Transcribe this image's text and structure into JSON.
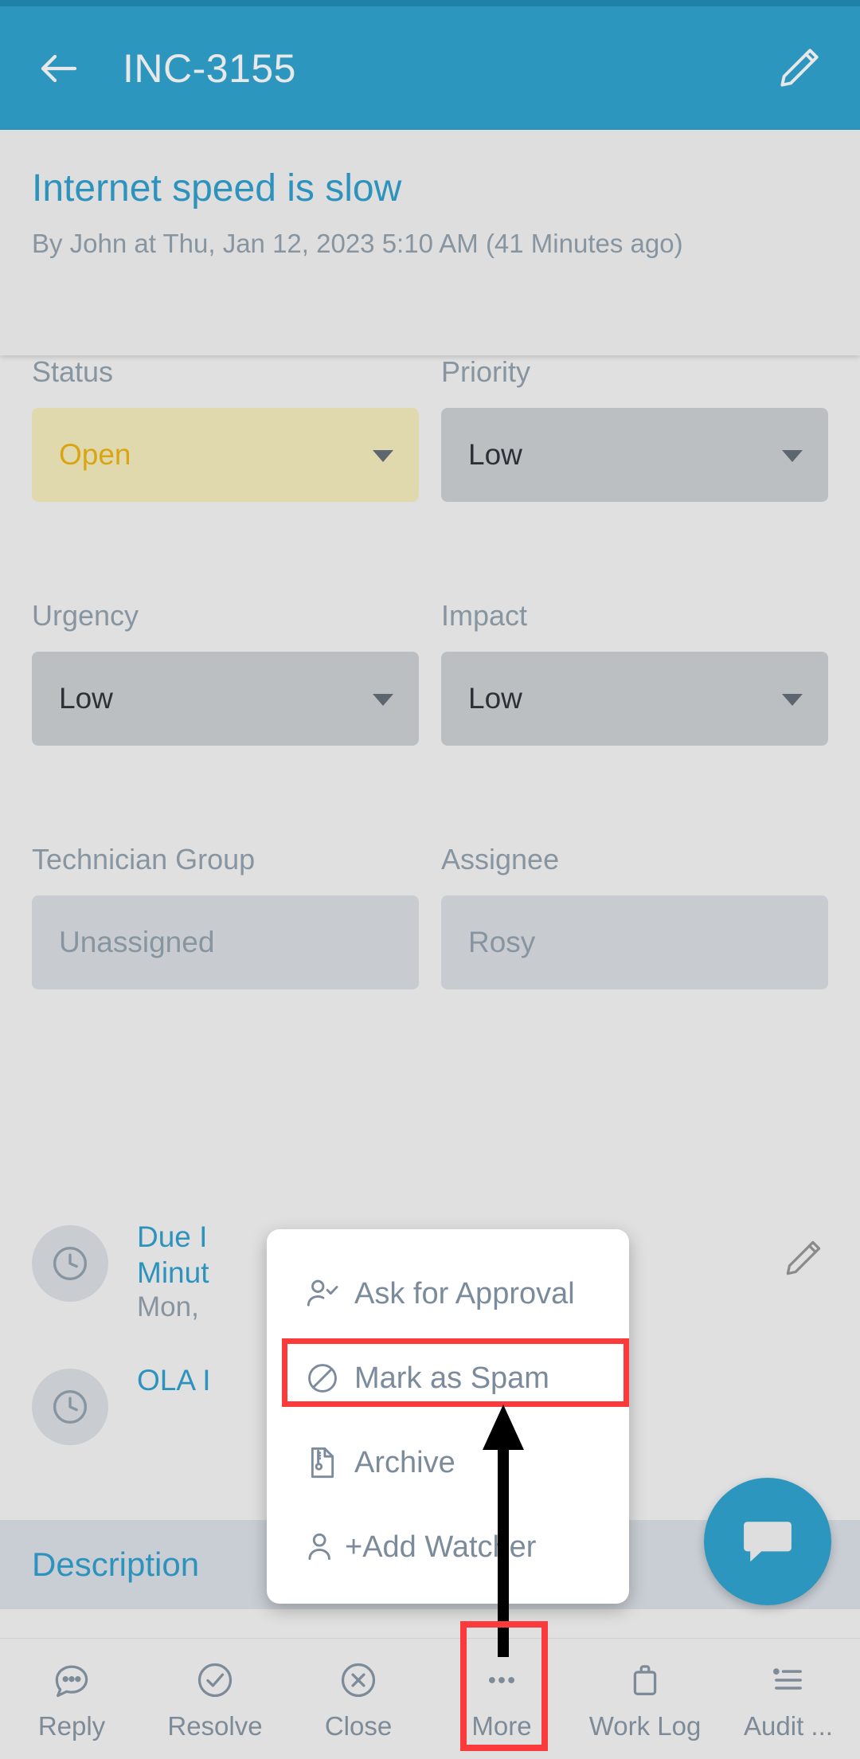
{
  "appbar": {
    "back_icon": "back-arrow-icon",
    "title": "INC-3155",
    "edit_icon": "pencil-edit-icon"
  },
  "ticket": {
    "title": "Internet speed is slow",
    "meta": "By John at Thu, Jan 12, 2023 5:10 AM (41 Minutes ago)"
  },
  "fields": [
    {
      "label": "Status",
      "value": "Open",
      "kind": "dropdown",
      "accent": "#d9a513",
      "bg": "#e0d9ae"
    },
    {
      "label": "Priority",
      "value": "Low",
      "kind": "dropdown",
      "accent": "#2b3137",
      "bg": "#bcbfc2"
    },
    {
      "label": "Urgency",
      "value": "Low",
      "kind": "dropdown",
      "accent": "#2b3137",
      "bg": "#bcbfc2"
    },
    {
      "label": "Impact",
      "value": "Low",
      "kind": "dropdown",
      "accent": "#2b3137",
      "bg": "#bcbfc2"
    },
    {
      "label": "Technician Group",
      "value": "Unassigned",
      "kind": "readonly",
      "accent": "#8795a1",
      "bg": "#c8ccd0"
    },
    {
      "label": "Assignee",
      "value": "Rosy",
      "kind": "readonly",
      "accent": "#8795a1",
      "bg": "#c8ccd0"
    }
  ],
  "sla": [
    {
      "icon": "clock-icon",
      "title": "Due I",
      "title2": "Minut",
      "sub": "Mon,",
      "edit_icon": "pencil-edit-icon"
    },
    {
      "icon": "clock-icon",
      "title": "OLA I",
      "title2": "",
      "sub": "",
      "edit_icon": ""
    }
  ],
  "description": {
    "label": "Description"
  },
  "fab": {
    "icon": "chat-bubble-icon"
  },
  "popup": {
    "items": [
      {
        "label": "Ask for Approval",
        "icon": "user-check-icon",
        "highlighted": false
      },
      {
        "label": "Mark as Spam",
        "icon": "block-icon",
        "highlighted": true
      },
      {
        "label": "Archive",
        "icon": "archive-file-icon",
        "highlighted": false
      },
      {
        "label": "+Add Watcher",
        "icon": "user-add-icon",
        "highlighted": false
      }
    ]
  },
  "bottombar": {
    "items": [
      {
        "label": "Reply",
        "icon": "chat-dots-icon",
        "highlighted": false
      },
      {
        "label": "Resolve",
        "icon": "check-circle-icon",
        "highlighted": false
      },
      {
        "label": "Close",
        "icon": "x-circle-icon",
        "highlighted": false
      },
      {
        "label": "More",
        "icon": "ellipsis-icon",
        "highlighted": true
      },
      {
        "label": "Work Log",
        "icon": "briefcase-icon",
        "highlighted": false
      },
      {
        "label": "Audit ...",
        "icon": "list-icon",
        "highlighted": false
      }
    ]
  },
  "colors": {
    "appbar": "#2d96be",
    "accent_link": "#2d93bd",
    "page_bg": "#e0e0e0",
    "highlight_red": "#fb3b3b",
    "status_open_text": "#d9a513",
    "label_grey": "#8795a1"
  }
}
